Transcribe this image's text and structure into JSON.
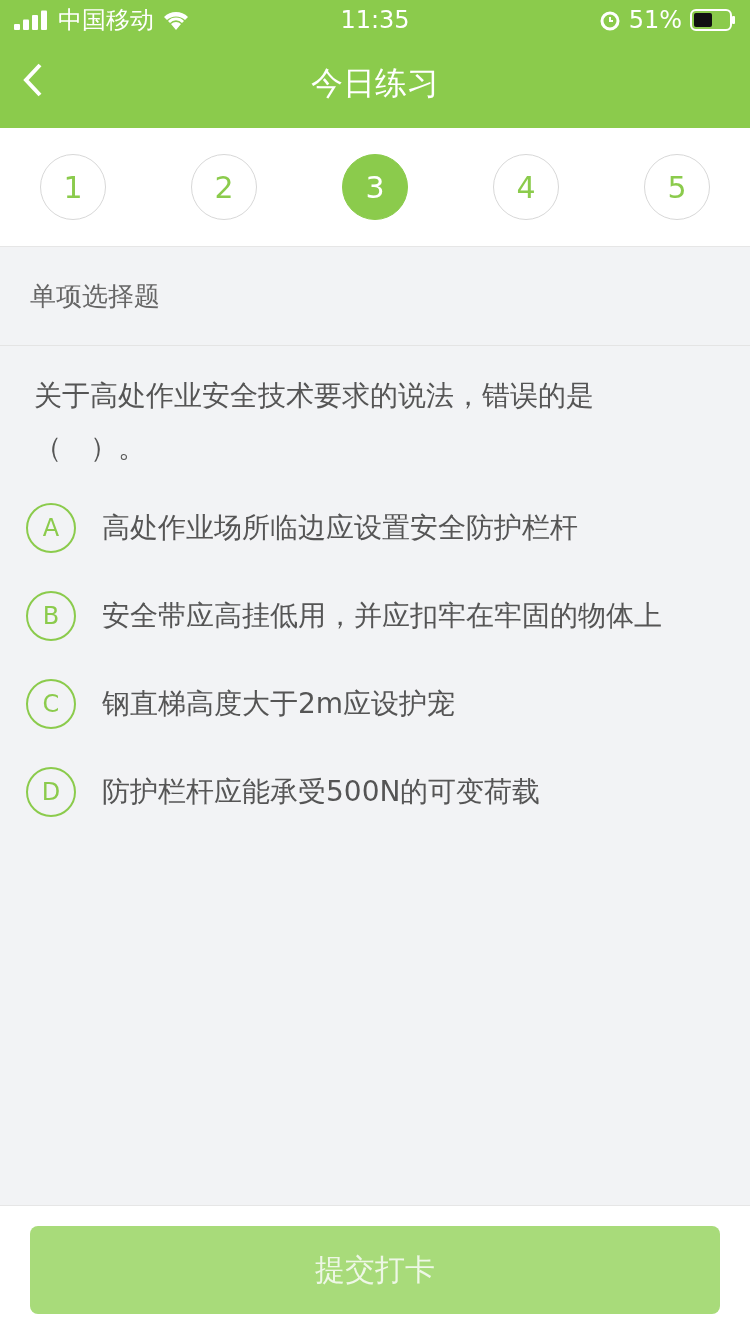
{
  "status_bar": {
    "carrier": "中国移动",
    "time": "11:35",
    "battery": "51%"
  },
  "nav": {
    "title": "今日练习"
  },
  "steps": [
    {
      "label": "1",
      "selected": false
    },
    {
      "label": "2",
      "selected": false
    },
    {
      "label": "3",
      "selected": true
    },
    {
      "label": "4",
      "selected": false
    },
    {
      "label": "5",
      "selected": false
    }
  ],
  "question_type": "单项选择题",
  "question": "关于高处作业安全技术要求的说法，错误的是（　）。",
  "options": [
    {
      "letter": "A",
      "text": "高处作业场所临边应设置安全防护栏杆",
      "selected": false
    },
    {
      "letter": "B",
      "text": "安全带应高挂低用，并应扣牢在牢固的物体上",
      "selected": false
    },
    {
      "letter": "C",
      "text": "钢直梯高度大于2m应设护宠",
      "selected": false
    },
    {
      "letter": "D",
      "text": "防护栏杆应能承受500N的可变荷载",
      "selected": false
    }
  ],
  "submit": {
    "label": "提交打卡",
    "disabled": true
  }
}
